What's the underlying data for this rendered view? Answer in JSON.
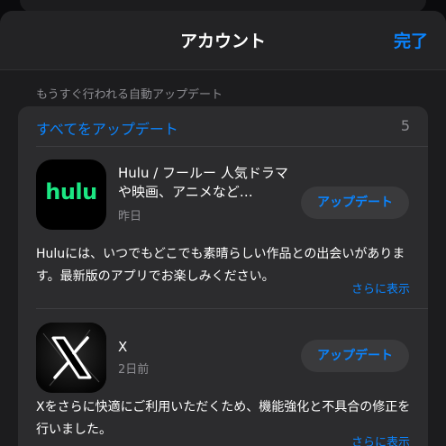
{
  "nav": {
    "title": "アカウント",
    "done_label": "完了"
  },
  "section": {
    "header": "もうすぐ行われる自動アップデート"
  },
  "update_all": {
    "label": "すべてをアップデート",
    "count": "5"
  },
  "apps": [
    {
      "icon_text": "hulu",
      "icon_name": "hulu-app-icon",
      "name": "Hulu / フールー 人気ドラマや映画、アニメなど…",
      "date": "昨日",
      "button_label": "アップデート",
      "notes": "Huluには、いつでもどこでも素晴らしい作品との出会いがあります。最新版のアプリでお楽しみください。",
      "more_label": "さらに表示"
    },
    {
      "icon_name": "x-app-icon",
      "name": "X",
      "date": "2日前",
      "button_label": "アップデート",
      "notes": "Xをさらに快適にご利用いただくため、機能強化と不具合の修正を行いました。",
      "more_label": "さらに表示"
    }
  ],
  "colors": {
    "accent": "#0a84ff",
    "hulu_green": "#1ce783",
    "background": "#1c1c1e",
    "card": "#2c2c2e"
  }
}
